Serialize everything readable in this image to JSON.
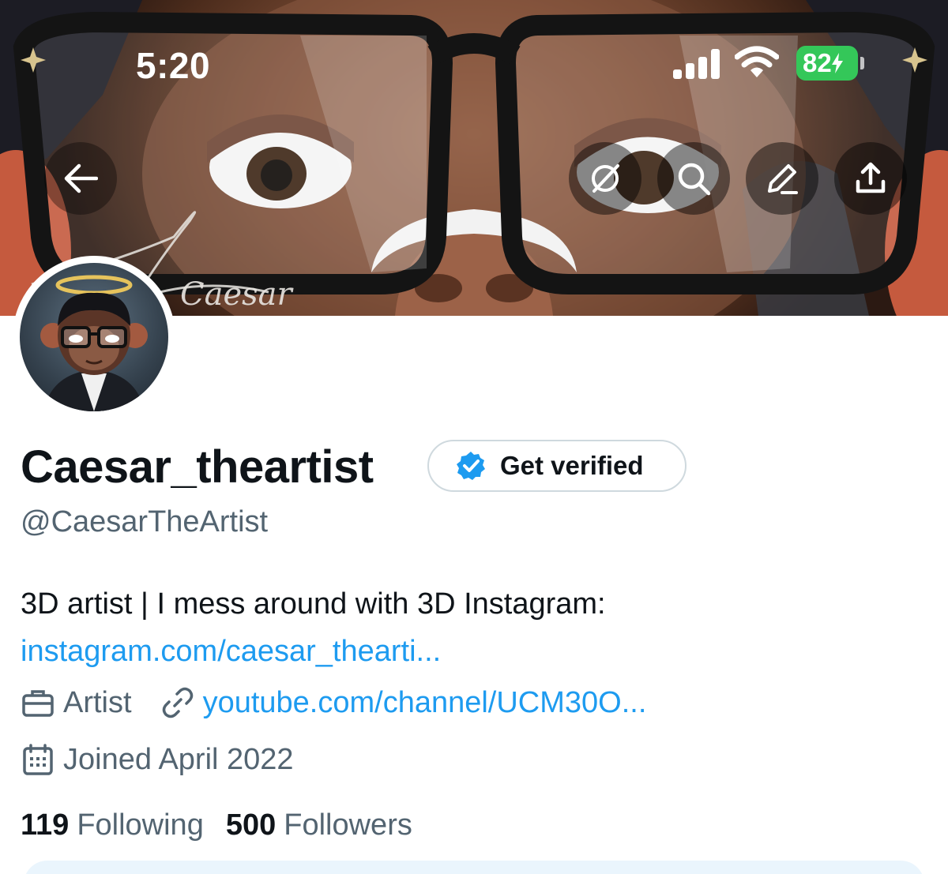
{
  "status_bar": {
    "time": "5:20",
    "battery": "82"
  },
  "banner": {
    "signature": "Caesar",
    "buttons": [
      {
        "name": "back",
        "icon": "arrow-left-icon"
      },
      {
        "name": "grok",
        "icon": "grok-icon"
      },
      {
        "name": "search",
        "icon": "search-icon"
      },
      {
        "name": "edit",
        "icon": "pencil-icon"
      },
      {
        "name": "share",
        "icon": "share-icon"
      }
    ]
  },
  "profile": {
    "display_name": "Caesar_theartist",
    "get_verified_label": "Get verified",
    "handle": "@CaesarTheArtist",
    "bio_text": "3D artist | I mess around with 3D Instagram:",
    "bio_link": "instagram.com/caesar_thearti...",
    "category": "Artist",
    "website": "youtube.com/channel/UCM30O...",
    "joined": "Joined April 2022"
  },
  "stats": {
    "following_count": "119",
    "following_label": "Following",
    "followers_count": "500",
    "followers_label": "Followers"
  },
  "colors": {
    "link": "#1d9bf0",
    "secondary_text": "#536471",
    "battery": "#34c759",
    "verified_badge": "#1d9bf0"
  }
}
